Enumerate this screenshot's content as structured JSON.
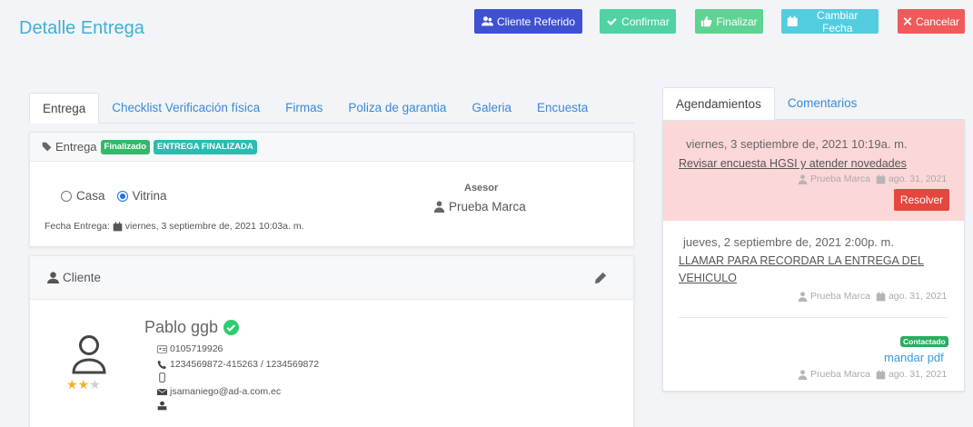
{
  "header": {
    "title": "Detalle Entrega",
    "buttons": {
      "cliente_referido": "Cliente Referido",
      "confirmar": "Confirmar",
      "finalizar": "Finalizar",
      "cambiar_fecha": "Cambiar Fecha",
      "cancelar": "Cancelar"
    }
  },
  "left_tabs": [
    "Entrega",
    "Checklist Verificación física",
    "Firmas",
    "Poliza de garantia",
    "Galeria",
    "Encuesta"
  ],
  "entrega_card": {
    "title": "Entrega",
    "badge_status": "Finalizado",
    "badge_state": "ENTREGA FINALIZADA",
    "radio_casa": "Casa",
    "radio_vitrina": "Vitrina",
    "selected": "Vitrina",
    "fecha_label": "Fecha Entrega:",
    "fecha_value": "viernes, 3 septiembre de, 2021 10:03a. m.",
    "asesor_label": "Asesor",
    "asesor_value": "Prueba Marca"
  },
  "cliente_card": {
    "title": "Cliente",
    "name": "Pablo ggb",
    "id_number": "0105719926",
    "phones": "1234569872-415263 / 1234569872",
    "mobile": "",
    "email": "jsamaniego@ad-a.com.ec",
    "rating": 2,
    "rating_max": 3
  },
  "right_tabs": [
    "Agendamientos",
    "Comentarios"
  ],
  "agendamientos": [
    {
      "date": "viernes, 3 septiembre de, 2021 10:19a. m.",
      "title": "Revisar encuesta HGSI y atender novedades",
      "author": "Prueba Marca",
      "created": "ago. 31, 2021",
      "action": "Resolver",
      "color": "#fcd7d7"
    },
    {
      "date": "jueves, 2 septiembre de, 2021 2:00p. m.",
      "title_line1": "LLAMAR PARA RECORDAR LA ENTREGA DEL",
      "title_line2": "VEHICULO",
      "author": "Prueba Marca",
      "created": "ago. 31, 2021"
    },
    {
      "badge": "Contactado",
      "title": "mandar pdf",
      "author": "Prueba Marca",
      "created": "ago. 31, 2021"
    }
  ]
}
